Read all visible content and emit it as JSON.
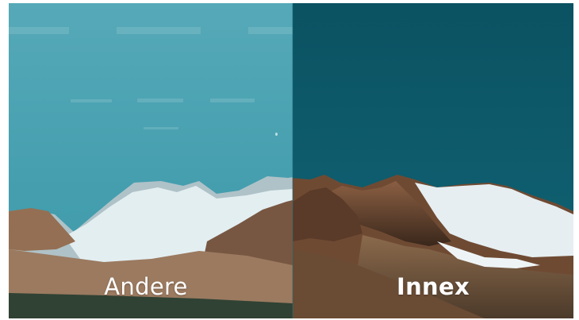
{
  "comparison": {
    "left_label": "Andere",
    "right_label": "Innex"
  },
  "colors": {
    "left_sky": "#449eae",
    "right_sky": "#0d5a6a",
    "snow": "#eef4f6",
    "rock": "#6f4a33",
    "text": "#ffffff"
  }
}
